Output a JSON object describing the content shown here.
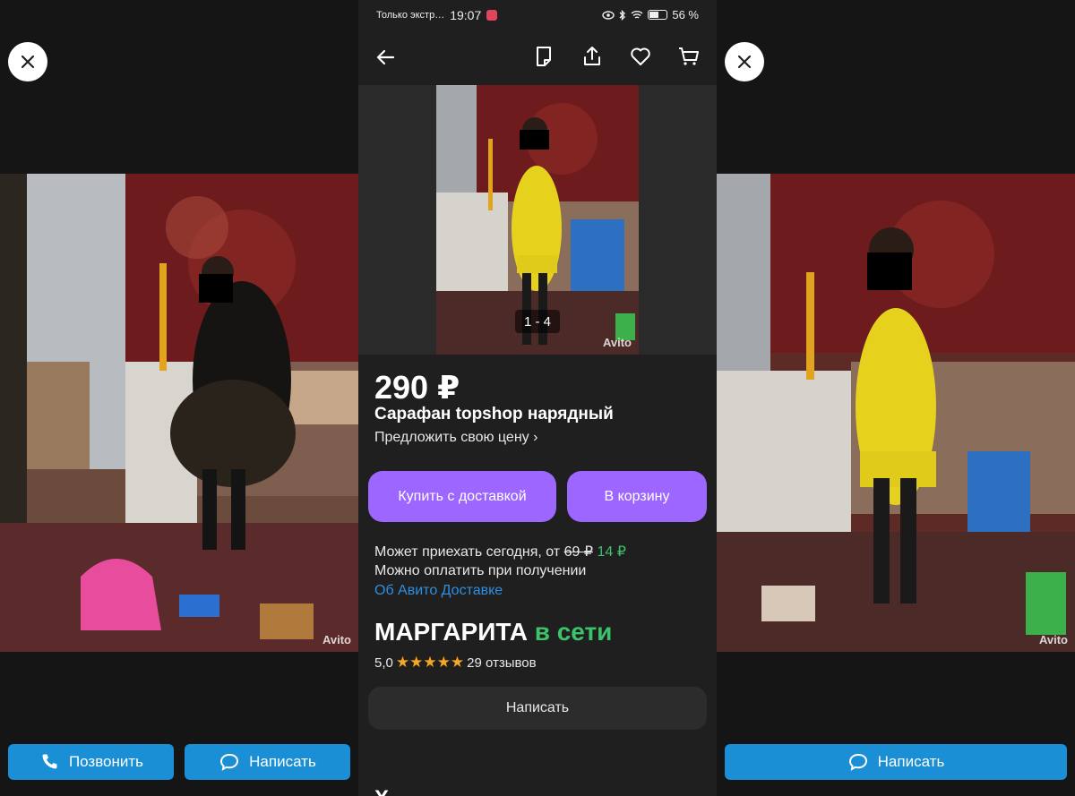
{
  "left_panel": {
    "watermark": "Avito",
    "call_button": "Позвонить",
    "write_button": "Написать"
  },
  "right_panel": {
    "watermark": "Avito",
    "write_button": "Написать"
  },
  "status_bar": {
    "carrier": "Только экстр…",
    "time": "19:07",
    "battery": "56 %",
    "battery_level": 0.56
  },
  "listing": {
    "photo_counter": "1 - 4",
    "watermark": "Avito",
    "price": "290 ₽",
    "title": "Сарафан topshop нарядный",
    "offer_price": "Предложить свою цену",
    "buy_delivery": "Купить с доставкой",
    "add_to_cart": "В корзину",
    "delivery_line_prefix": "Может приехать сегодня, от",
    "delivery_old_price": "69 ₽",
    "delivery_new_price": "14 ₽",
    "payment_line": "Можно оплатить при получении",
    "delivery_link": "Об Авито Доставке",
    "seller_name": "МАРГАРИТА",
    "seller_status": "в сети",
    "rating_value": "5,0",
    "stars": 5,
    "reviews": "29 отзывов",
    "write_button": "Написать",
    "next_section_partial": "Х"
  },
  "colors": {
    "accent_purple": "#9d66ff",
    "blue_button": "#1a8fd6",
    "online_green": "#3cc26a",
    "link_blue": "#2e8fe0",
    "star": "#f5a623"
  }
}
